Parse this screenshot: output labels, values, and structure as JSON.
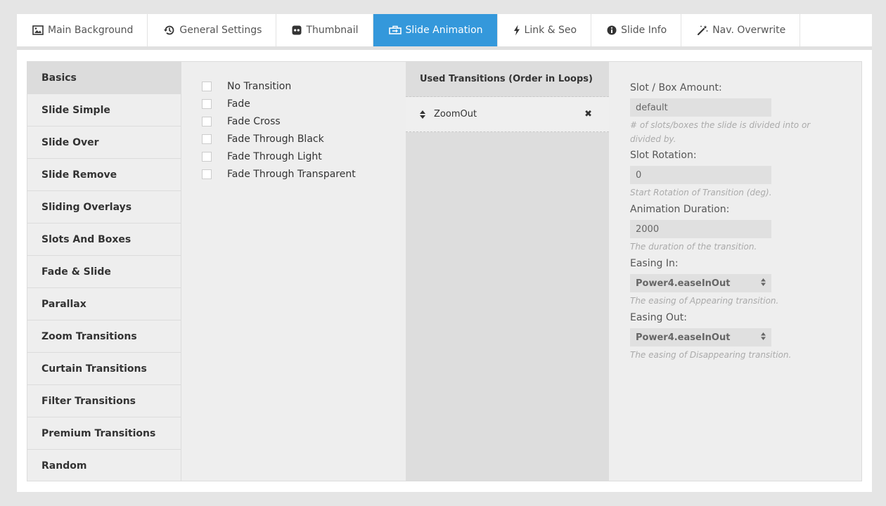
{
  "tabs": [
    {
      "label": "Main Background",
      "icon": "image-icon",
      "active": false
    },
    {
      "label": "General Settings",
      "icon": "history-icon",
      "active": false
    },
    {
      "label": "Thumbnail",
      "icon": "thumbnail-icon",
      "active": false
    },
    {
      "label": "Slide Animation",
      "icon": "animation-icon",
      "active": true
    },
    {
      "label": "Link & Seo",
      "icon": "bolt-icon",
      "active": false
    },
    {
      "label": "Slide Info",
      "icon": "info-icon",
      "active": false
    },
    {
      "label": "Nav. Overwrite",
      "icon": "magic-wand-icon",
      "active": false
    }
  ],
  "categories": [
    "Basics",
    "Slide Simple",
    "Slide Over",
    "Slide Remove",
    "Sliding Overlays",
    "Slots And Boxes",
    "Fade & Slide",
    "Parallax",
    "Zoom Transitions",
    "Curtain Transitions",
    "Filter Transitions",
    "Premium Transitions",
    "Random"
  ],
  "active_category": "Basics",
  "transitions": [
    "No Transition",
    "Fade",
    "Fade Cross",
    "Fade Through Black",
    "Fade Through Light",
    "Fade Through Transparent"
  ],
  "used": {
    "title": "Used Transitions (Order in Loops)",
    "items": [
      "ZoomOut"
    ],
    "remove_symbol": "✖"
  },
  "settings": {
    "slot_amount": {
      "label": "Slot / Box Amount:",
      "value": "default",
      "hint": "# of slots/boxes the slide is divided into or divided by."
    },
    "slot_rotation": {
      "label": "Slot Rotation:",
      "value": "0",
      "hint": "Start Rotation of Transition (deg)."
    },
    "duration": {
      "label": "Animation Duration:",
      "value": "2000",
      "hint": "The duration of the transition."
    },
    "easing_in": {
      "label": "Easing In:",
      "value": "Power4.easeInOut",
      "hint": "The easing of Appearing transition."
    },
    "easing_out": {
      "label": "Easing Out:",
      "value": "Power4.easeInOut",
      "hint": "The easing of Disappearing transition."
    }
  },
  "colors": {
    "accent": "#3498db"
  }
}
